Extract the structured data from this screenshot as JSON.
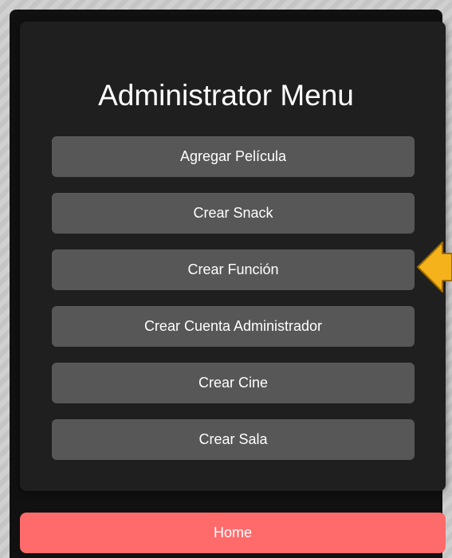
{
  "title": "Administrator Menu",
  "menu": [
    {
      "label": "Agregar Película"
    },
    {
      "label": "Crear Snack"
    },
    {
      "label": "Crear Función"
    },
    {
      "label": "Crear Cuenta Administrador"
    },
    {
      "label": "Crear Cine"
    },
    {
      "label": "Crear Sala"
    }
  ],
  "home": {
    "label": "Home"
  },
  "colors": {
    "card": "#1f1f1f",
    "menu_button": "#575757",
    "home_button": "#ff6b6b",
    "arrow": "#f6b21b"
  },
  "icons": {
    "arrow": "left-pointing-arrow-icon"
  }
}
